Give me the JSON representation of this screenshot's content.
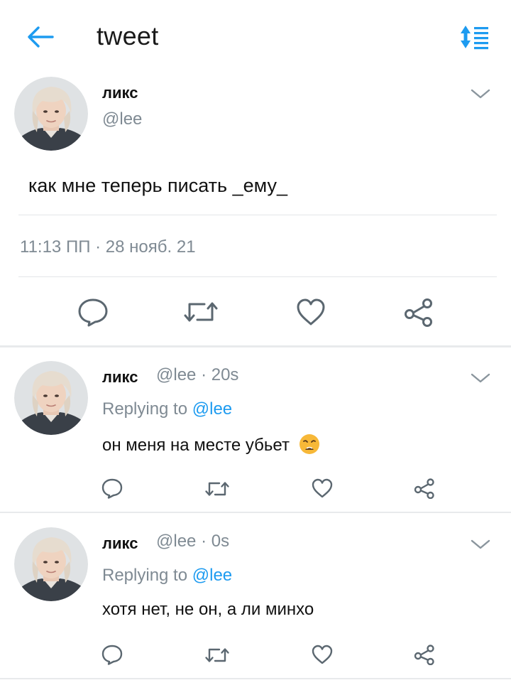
{
  "header": {
    "title": "tweet",
    "back_icon": "arrow-left-icon",
    "sort_icon": "sort-list-icon",
    "accent": "#1d9bf0"
  },
  "main_tweet": {
    "name": "ликс",
    "handle": "@lee",
    "text": "как мне теперь писать _ему_",
    "time": "11:13 ПП",
    "sep": "·",
    "date": "28 нояб. 21"
  },
  "replies": [
    {
      "name": "ликс",
      "handle": "@lee",
      "sep": "·",
      "age": "20s",
      "replying_label": "Replying to",
      "replying_to": "@lee",
      "text": "он меня на месте убьет",
      "emoji": "weary-face"
    },
    {
      "name": "ликс",
      "handle": "@lee",
      "sep": "·",
      "age": "0s",
      "replying_label": "Replying to",
      "replying_to": "@lee",
      "text": "хотя нет, не он, а ли минхо"
    }
  ],
  "actions": [
    "reply-icon",
    "retweet-icon",
    "like-icon",
    "share-icon"
  ],
  "colors": {
    "text": "#111111",
    "muted": "#7f8a93",
    "icon": "#5b6770",
    "divider": "#e3e6e8"
  }
}
